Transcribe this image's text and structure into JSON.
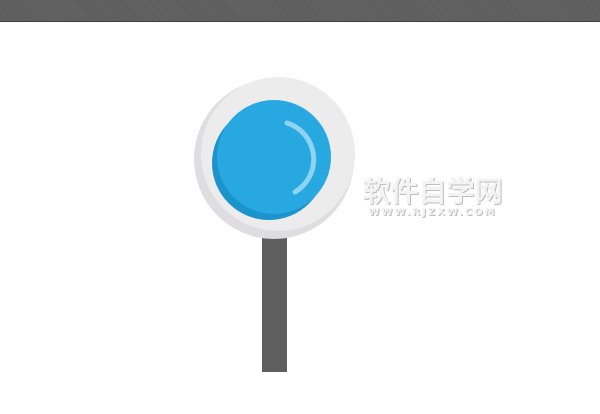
{
  "watermark": {
    "title": "软件自学网",
    "url": "WWW.RJZXW.COM"
  },
  "colors": {
    "top_bar": "#5f5f5f",
    "background": "#ffffff",
    "outer_ring": "#ececed",
    "outer_ring_shadow": "#dedee0",
    "lens": "#28a8e0",
    "lens_shadow": "#1b93cc",
    "highlight": "#8fd3f2",
    "handle": "#5f5f5f"
  },
  "icons": {
    "main": "lollipop-lens-icon"
  }
}
